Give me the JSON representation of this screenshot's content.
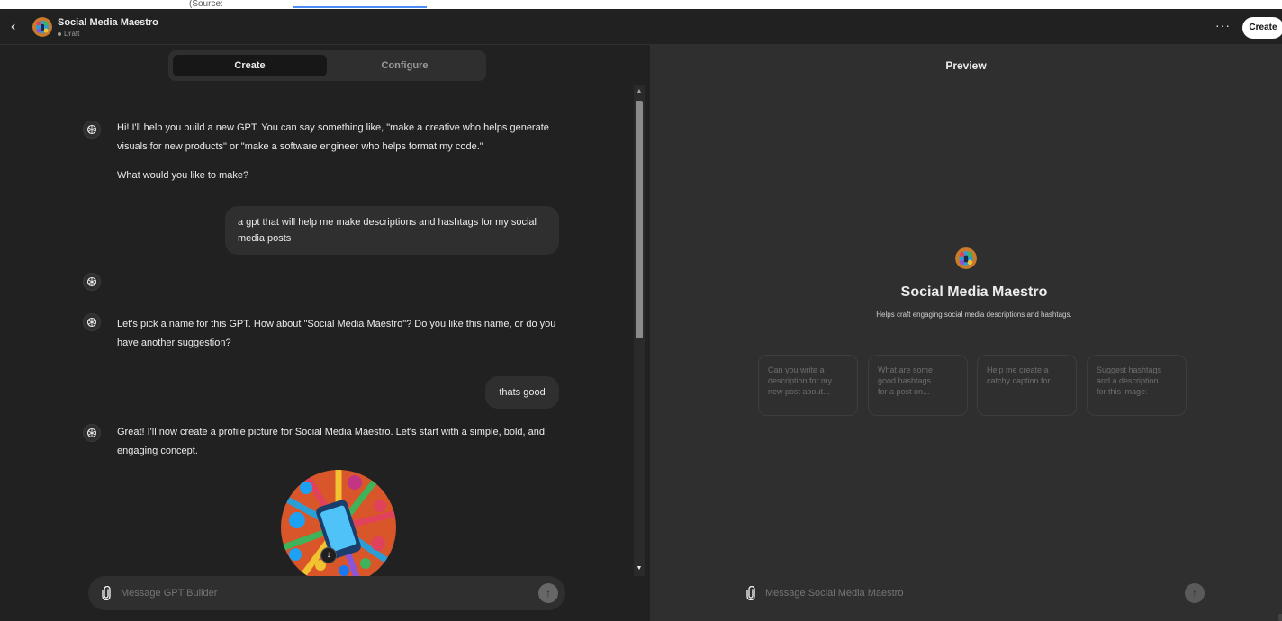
{
  "top_strip": {
    "text": "(Source: "
  },
  "header": {
    "title": "Social Media Maestro",
    "status": "Draft",
    "more": "···",
    "create_label": "Create"
  },
  "tabs": [
    {
      "label": "Create",
      "active": true
    },
    {
      "label": "Configure",
      "active": false
    }
  ],
  "chat": {
    "messages": [
      {
        "role": "assistant",
        "lines": [
          "Hi! I'll help you build a new GPT. You can say something like, \"make a creative who helps generate",
          "visuals for new products\" or \"make a software engineer who helps format my code.\"",
          "",
          "What would you like to make?"
        ]
      },
      {
        "role": "user",
        "lines": [
          "a gpt that will help me make descriptions and hashtags for my social",
          "media posts"
        ]
      },
      {
        "role": "assistant",
        "lines": []
      },
      {
        "role": "assistant",
        "lines": [
          "Let's pick a name for this GPT. How about \"Social Media Maestro\"? Do you like this name, or do you",
          "have another suggestion?"
        ]
      },
      {
        "role": "user",
        "lines": [
          "thats good"
        ]
      },
      {
        "role": "assistant",
        "lines": [
          "Great! I'll now create a profile picture for Social Media Maestro. Let's start with a simple, bold, and",
          "engaging concept."
        ]
      }
    ],
    "input_placeholder": "Message GPT Builder"
  },
  "preview": {
    "label": "Preview",
    "name": "Social Media Maestro",
    "description": "Helps craft engaging social media descriptions and hashtags.",
    "starters": [
      [
        "Can you write a",
        "description for my",
        "new post about..."
      ],
      [
        "What are some",
        "good hashtags",
        "for a post on..."
      ],
      [
        "Help me create a",
        "catchy caption for..."
      ],
      [
        "Suggest hashtags",
        "and a description",
        "for this image:"
      ]
    ],
    "input_placeholder": "Message Social Media Maestro"
  },
  "colors": {
    "left_bg": "#212121",
    "right_bg": "#2f2f2f",
    "bubble": "#2f2f2f",
    "text": "#ececec",
    "muted": "#9b9b9b"
  },
  "icons": [
    "back-chevron-icon",
    "openai-logo-icon",
    "paperclip-icon",
    "arrow-up-icon",
    "download-icon"
  ]
}
